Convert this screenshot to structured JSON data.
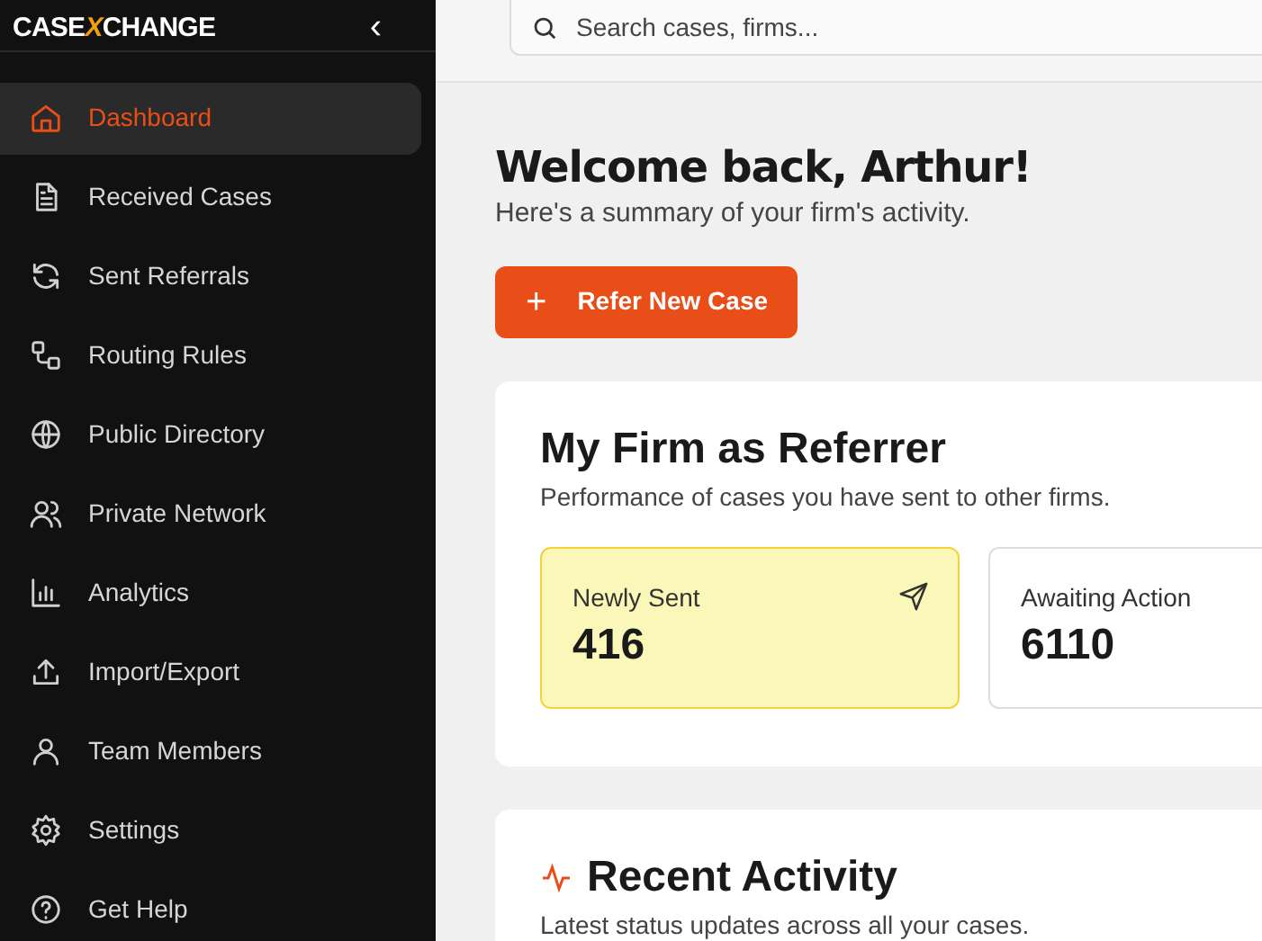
{
  "sidebar": {
    "logo": {
      "left": "CASE",
      "mark": "X",
      "right": "CHANGE"
    },
    "collapse": "‹",
    "items": [
      {
        "label": "Dashboard",
        "selected": true
      },
      {
        "label": "Received Cases",
        "selected": false
      },
      {
        "label": "Sent Referrals",
        "selected": false
      },
      {
        "label": "Routing Rules",
        "selected": false
      },
      {
        "label": "Public Directory",
        "selected": false
      },
      {
        "label": "Private Network",
        "selected": false
      },
      {
        "label": "Analytics",
        "selected": false
      },
      {
        "label": "Import/Export",
        "selected": false
      },
      {
        "label": "Team Members",
        "selected": false
      },
      {
        "label": "Settings",
        "selected": false
      },
      {
        "label": "Get Help",
        "selected": false
      }
    ]
  },
  "search": {
    "placeholder": "Search cases, firms..."
  },
  "welcome": {
    "title": "Welcome back, Arthur!",
    "subtitle": "Here's a summary of your firm's activity."
  },
  "primary_button": {
    "icon": "+",
    "label": "Refer New Case"
  },
  "referrer_card": {
    "title": "My Firm as Referrer",
    "subtitle": "Performance of cases you have sent to other firms.",
    "stats": [
      {
        "label": "Newly Sent",
        "value": "416",
        "selected": true
      },
      {
        "label": "Awaiting Action",
        "value": "6110",
        "selected": false
      }
    ]
  },
  "activity_card": {
    "title": "Recent Activity",
    "subtitle": "Latest status updates across all your cases."
  }
}
